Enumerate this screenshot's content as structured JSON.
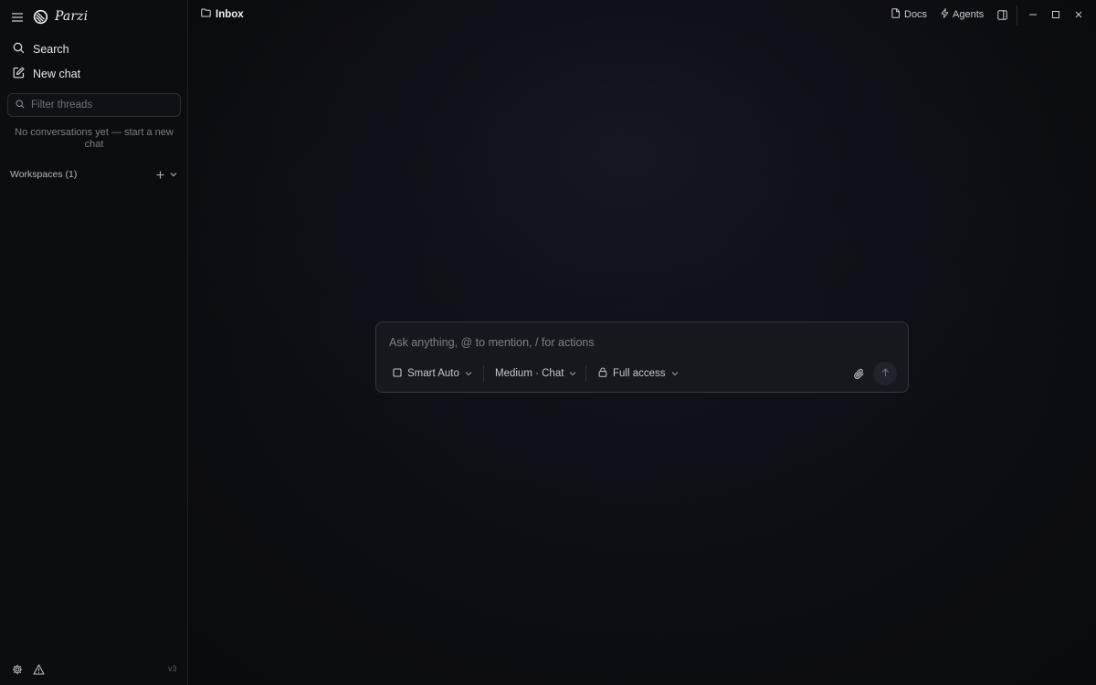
{
  "brand": {
    "name": "Parzi",
    "logo_icon": "no-entry-logo-icon"
  },
  "sidebar": {
    "menu_icon": "hamburger-menu-icon",
    "nav": [
      {
        "label": "Search",
        "icon": "search-icon"
      },
      {
        "label": "New chat",
        "icon": "edit-square-icon"
      }
    ],
    "filter": {
      "placeholder": "Filter threads",
      "value": ""
    },
    "empty_message": "No conversations yet — start a new chat",
    "workspaces_label": "Workspaces (1)",
    "footer": {
      "version": "v3",
      "settings_icon": "gear-icon",
      "warning_icon": "warning-triangle-icon"
    }
  },
  "header": {
    "breadcrumb": "Inbox",
    "breadcrumb_icon": "folder-icon",
    "actions": [
      {
        "label": "Docs",
        "icon": "document-icon"
      },
      {
        "label": "Agents",
        "icon": "lightning-icon"
      }
    ]
  },
  "composer": {
    "placeholder": "Ask anything, @ to mention, / for actions",
    "value": "",
    "model": "Smart Auto",
    "effort": "Medium · Chat",
    "access": "Full access"
  },
  "colors": {
    "background": "#0b0c10",
    "sidebar": "#0c0d11",
    "composer": "#16181e",
    "text": "#d6d8de",
    "muted": "#7a7e88"
  }
}
